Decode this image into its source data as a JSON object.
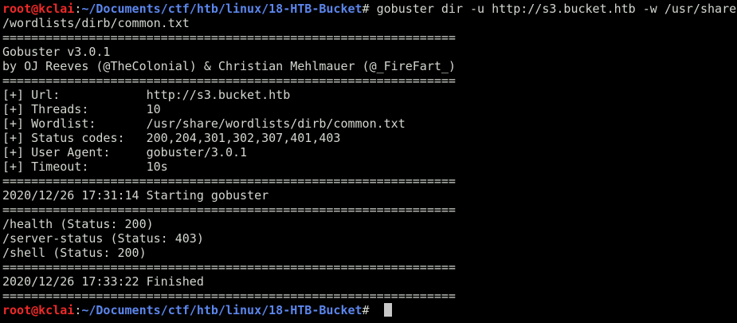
{
  "colors": {
    "background": "#000000",
    "text": "#d3d7cf",
    "prompt_user": "#ef2929",
    "prompt_path": "#5c86ec",
    "cursor": "#c8c8c8"
  },
  "prompt": {
    "user": "root@kclai",
    "separator": ":",
    "path": "~/Documents/ctf/htb/linux/18-HTB-Bucket",
    "symbol": "# "
  },
  "command": {
    "text": "gobuster dir -u http://s3.bucket.htb -w /usr/share",
    "wrap": "/wordlists/dirb/common.txt"
  },
  "separator": "===============================================================",
  "banner": {
    "version": "Gobuster v3.0.1",
    "authors": "by OJ Reeves (@TheColonial) & Christian Mehlmauer (@_FireFart_)"
  },
  "config": [
    {
      "label": "[+] Url:            ",
      "value": "http://s3.bucket.htb"
    },
    {
      "label": "[+] Threads:        ",
      "value": "10"
    },
    {
      "label": "[+] Wordlist:       ",
      "value": "/usr/share/wordlists/dirb/common.txt"
    },
    {
      "label": "[+] Status codes:   ",
      "value": "200,204,301,302,307,401,403"
    },
    {
      "label": "[+] User Agent:     ",
      "value": "gobuster/3.0.1"
    },
    {
      "label": "[+] Timeout:        ",
      "value": "10s"
    }
  ],
  "start_line": "2020/12/26 17:31:14 Starting gobuster",
  "results": [
    "/health (Status: 200)",
    "/server-status (Status: 403)",
    "/shell (Status: 200)"
  ],
  "finish_line": "2020/12/26 17:33:22 Finished"
}
